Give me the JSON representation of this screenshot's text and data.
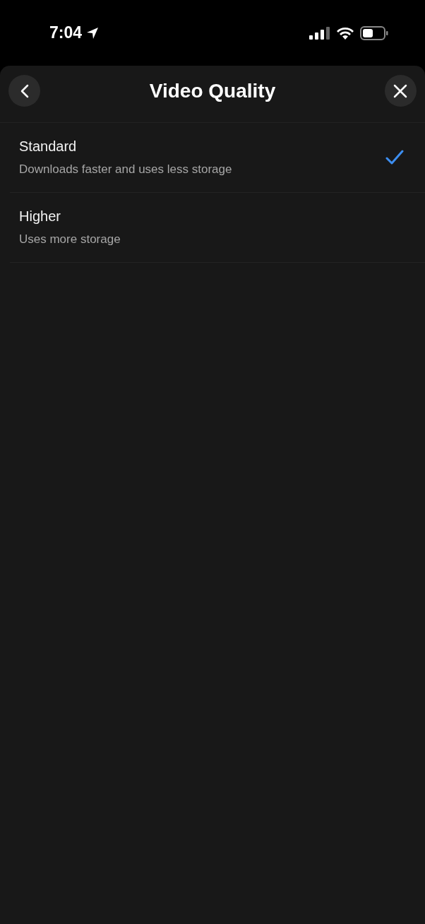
{
  "status_bar": {
    "time": "7:04"
  },
  "header": {
    "title": "Video Quality"
  },
  "options": [
    {
      "title": "Standard",
      "description": "Downloads faster and uses less storage",
      "selected": true
    },
    {
      "title": "Higher",
      "description": "Uses more storage",
      "selected": false
    }
  ]
}
